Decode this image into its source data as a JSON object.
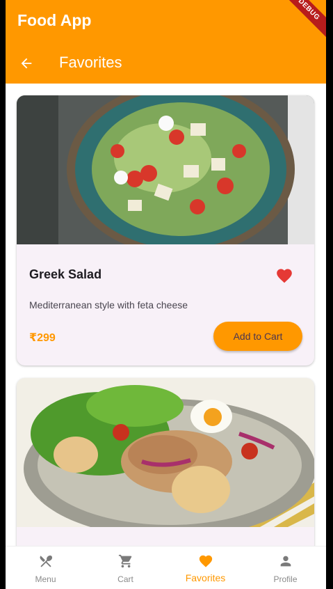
{
  "app": {
    "title": "Food App",
    "page_title": "Favorites",
    "debug_banner": "DEBUG"
  },
  "colors": {
    "primary": "#ff9800",
    "favorite": "#e53935",
    "card_bg": "#f8f1f8"
  },
  "favorites": [
    {
      "name": "Greek Salad",
      "description": "Mediterranean style with feta cheese",
      "price": "₹299",
      "button": "Add to Cart",
      "icon": "heart-icon"
    },
    {
      "name": "",
      "icon": "heart-icon"
    }
  ],
  "nav": {
    "items": [
      {
        "label": "Menu",
        "icon": "restaurant-icon"
      },
      {
        "label": "Cart",
        "icon": "cart-icon"
      },
      {
        "label": "Favorites",
        "icon": "heart-icon",
        "selected": true
      },
      {
        "label": "Profile",
        "icon": "person-icon"
      }
    ]
  }
}
